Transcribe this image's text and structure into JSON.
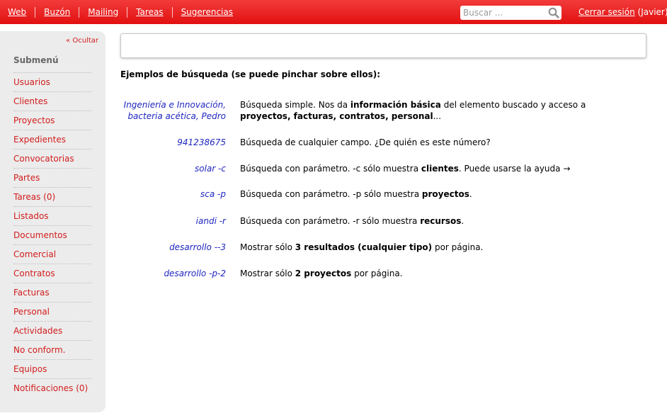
{
  "topnav": {
    "links": [
      "Web",
      "Buzón",
      "Mailing",
      "Tareas",
      "Sugerencias"
    ],
    "search_placeholder": "Buscar ...",
    "logout_label": "Cerrar sesión",
    "user": "(Javier)"
  },
  "sidebar": {
    "hide_label": "« Ocultar",
    "title": "Submenú",
    "items": [
      "Usuarios",
      "Clientes",
      "Proyectos",
      "Expedientes",
      "Convocatorias",
      "Partes",
      "Tareas (0)",
      "Listados",
      "Documentos",
      "Comercial",
      "Contratos",
      "Facturas",
      "Personal",
      "Actividades",
      "No conform.",
      "Equipos",
      "Notificaciones (0)"
    ]
  },
  "main": {
    "heading": "Ejemplos de búsqueda (se puede pinchar sobre ellos):",
    "examples": [
      {
        "query": [
          "Ingeniería e Innovación,",
          "bacteria acética, Pedro"
        ],
        "desc": [
          [
            "Búsqueda simple. Nos da ",
            false
          ],
          [
            "información básica",
            true
          ],
          [
            " del elemento buscado y acceso a ",
            false
          ],
          [
            "proyectos, facturas, contratos, personal",
            true
          ],
          [
            "...",
            false
          ]
        ]
      },
      {
        "query": [
          "941238675"
        ],
        "desc": [
          [
            "Búsqueda de cualquier campo. ¿De quién es este número?",
            false
          ]
        ]
      },
      {
        "query": [
          "solar -c"
        ],
        "desc": [
          [
            "Búsqueda con parámetro. -c sólo muestra ",
            false
          ],
          [
            "clientes",
            true
          ],
          [
            ". Puede usarse la ayuda →",
            false
          ]
        ]
      },
      {
        "query": [
          "sca -p"
        ],
        "desc": [
          [
            "Búsqueda con parámetro. -p sólo muestra ",
            false
          ],
          [
            "proyectos",
            true
          ],
          [
            ".",
            false
          ]
        ]
      },
      {
        "query": [
          "iandi -r"
        ],
        "desc": [
          [
            "Búsqueda con parámetro. -r sólo muestra ",
            false
          ],
          [
            "recursos",
            true
          ],
          [
            ".",
            false
          ]
        ]
      },
      {
        "query": [
          "desarrollo --3"
        ],
        "desc": [
          [
            "Mostrar sólo ",
            false
          ],
          [
            "3 resultados (cualquier tipo)",
            true
          ],
          [
            " por página.",
            false
          ]
        ]
      },
      {
        "query": [
          "desarrollo -p-2"
        ],
        "desc": [
          [
            "Mostrar sólo ",
            false
          ],
          [
            "2 proyectos",
            true
          ],
          [
            " por página.",
            false
          ]
        ]
      }
    ]
  },
  "colors": {
    "topbar": "#e21010",
    "link": "#d21c1c",
    "query": "#1f26bf",
    "sidebar_bg": "#ececec"
  }
}
